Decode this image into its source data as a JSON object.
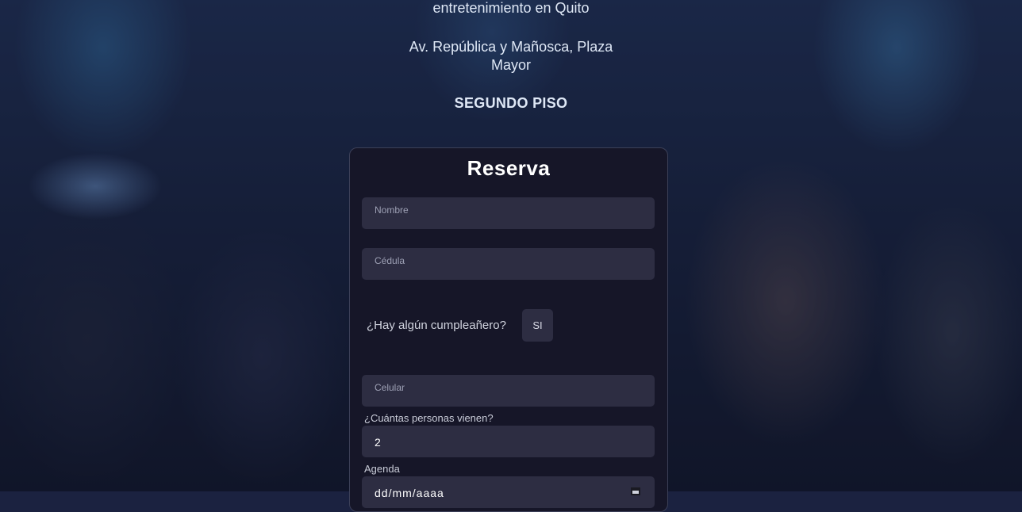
{
  "header": {
    "tagline": "entretenimiento en Quito",
    "address": "Av. República y Mañosca, Plaza Mayor",
    "floor": "SEGUNDO PISO"
  },
  "reservation": {
    "title": "Reserva",
    "name_placeholder": "Nombre",
    "id_placeholder": "Cédula",
    "birthday_question": "¿Hay algún cumpleañero?",
    "birthday_button": "SI",
    "phone_placeholder": "Celular",
    "people_label": "¿Cuántas personas vienen?",
    "people_value": "2",
    "date_label": "Agenda",
    "date_placeholder": "dd/mm/aaaa"
  },
  "icons": {
    "date": "calendar-icon"
  }
}
